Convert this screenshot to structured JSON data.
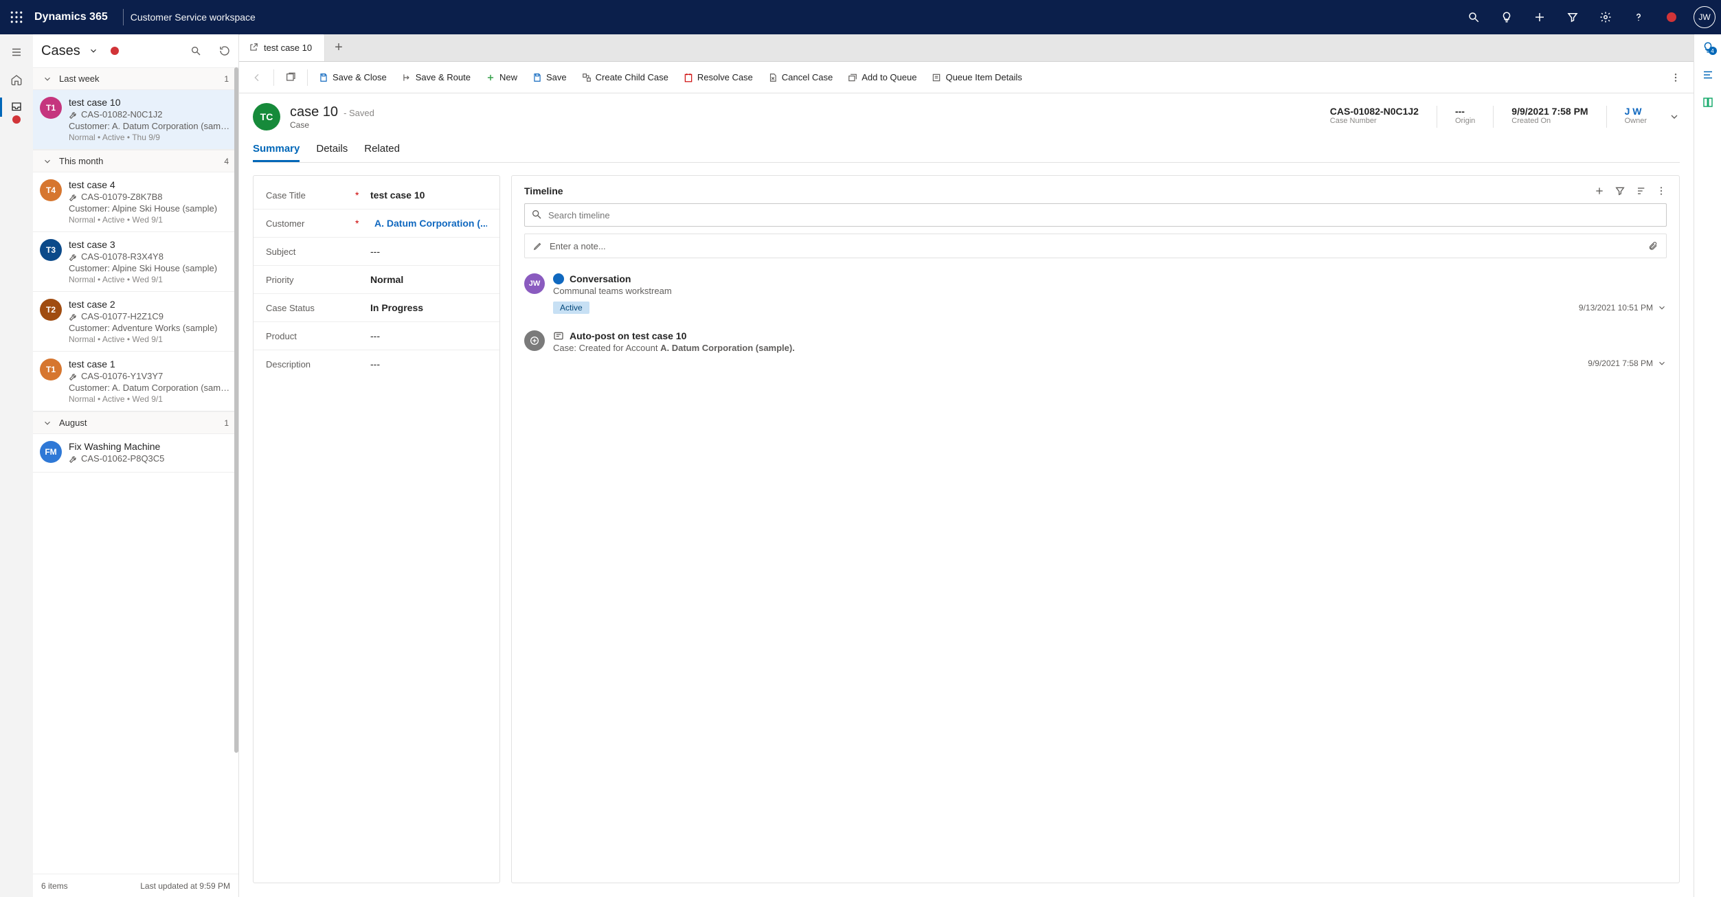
{
  "navbar": {
    "brand": "Dynamics 365",
    "workspace": "Customer Service workspace",
    "avatar": "JW"
  },
  "caseList": {
    "title": "Cases",
    "footer_count": "6 items",
    "footer_updated": "Last updated at 9:59 PM",
    "groups": [
      {
        "label": "Last week",
        "count": "1",
        "items": [
          {
            "badge": "T1",
            "color": "#c5357e",
            "title": "test case 10",
            "casenum": "CAS-01082-N0C1J2",
            "customer": "Customer: A. Datum Corporation (sampl...",
            "meta": "Normal • Active • Thu 9/9",
            "selected": true
          }
        ]
      },
      {
        "label": "This month",
        "count": "4",
        "items": [
          {
            "badge": "T4",
            "color": "#d6762f",
            "title": "test case 4",
            "casenum": "CAS-01079-Z8K7B8",
            "customer": "Customer: Alpine Ski House (sample)",
            "meta": "Normal • Active • Wed 9/1",
            "selected": false
          },
          {
            "badge": "T3",
            "color": "#0b4a8a",
            "title": "test case 3",
            "casenum": "CAS-01078-R3X4Y8",
            "customer": "Customer: Alpine Ski House (sample)",
            "meta": "Normal • Active • Wed 9/1",
            "selected": false
          },
          {
            "badge": "T2",
            "color": "#a04c10",
            "title": "test case 2",
            "casenum": "CAS-01077-H2Z1C9",
            "customer": "Customer: Adventure Works (sample)",
            "meta": "Normal • Active • Wed 9/1",
            "selected": false
          },
          {
            "badge": "T1",
            "color": "#d6762f",
            "title": "test case 1",
            "casenum": "CAS-01076-Y1V3Y7",
            "customer": "Customer: A. Datum Corporation (sampl...",
            "meta": "Normal • Active • Wed 9/1",
            "selected": false
          }
        ]
      },
      {
        "label": "August",
        "count": "1",
        "items": [
          {
            "badge": "FM",
            "color": "#2e78d6",
            "title": "Fix Washing Machine",
            "casenum": "CAS-01062-P8Q3C5",
            "customer": "",
            "meta": "",
            "selected": false
          }
        ]
      }
    ]
  },
  "tabstrip": {
    "tab_label": "test case 10"
  },
  "cmdbar": {
    "save_close": "Save & Close",
    "save_route": "Save & Route",
    "new": "New",
    "save": "Save",
    "create_child": "Create Child Case",
    "resolve": "Resolve Case",
    "cancel": "Cancel Case",
    "queue": "Add to Queue",
    "queue_details": "Queue Item Details"
  },
  "record": {
    "avatar": "TC",
    "title": "case 10",
    "saved": " - Saved",
    "entity": "Case",
    "kpis": {
      "case_number": {
        "val": "CAS-01082-N0C1J2",
        "lab": "Case Number"
      },
      "origin": {
        "val": "---",
        "lab": "Origin"
      },
      "created_on": {
        "val": "9/9/2021 7:58 PM",
        "lab": "Created On"
      },
      "owner": {
        "val": "J W",
        "lab": "Owner"
      }
    }
  },
  "subtabs": {
    "summary": "Summary",
    "details": "Details",
    "related": "Related"
  },
  "fields": {
    "case_title": {
      "label": "Case Title",
      "value": "test case 10",
      "required": true
    },
    "customer": {
      "label": "Customer",
      "value": "A. Datum Corporation (...",
      "required": true,
      "link": true
    },
    "subject": {
      "label": "Subject",
      "value": "---"
    },
    "priority": {
      "label": "Priority",
      "value": "Normal"
    },
    "case_status": {
      "label": "Case Status",
      "value": "In Progress"
    },
    "product": {
      "label": "Product",
      "value": "---"
    },
    "description": {
      "label": "Description",
      "value": "---"
    }
  },
  "timeline": {
    "title": "Timeline",
    "search_placeholder": "Search timeline",
    "note_placeholder": "Enter a note...",
    "items": [
      {
        "avatar": "JW",
        "avcolor": "#8a5bbf",
        "iconcolor": "#1068bf",
        "title": "Conversation",
        "sub": "Communal teams workstream",
        "pill": "Active",
        "time": "9/13/2021 10:51 PM"
      },
      {
        "avatar": "",
        "avcolor": "#7a7a7a",
        "iconcolor": "#605e5c",
        "title": "Auto-post on test case 10",
        "sub_prefix": "Case: Created for Account ",
        "sub_bold": "A. Datum Corporation (sample).",
        "time": "9/9/2021 7:58 PM"
      }
    ]
  }
}
